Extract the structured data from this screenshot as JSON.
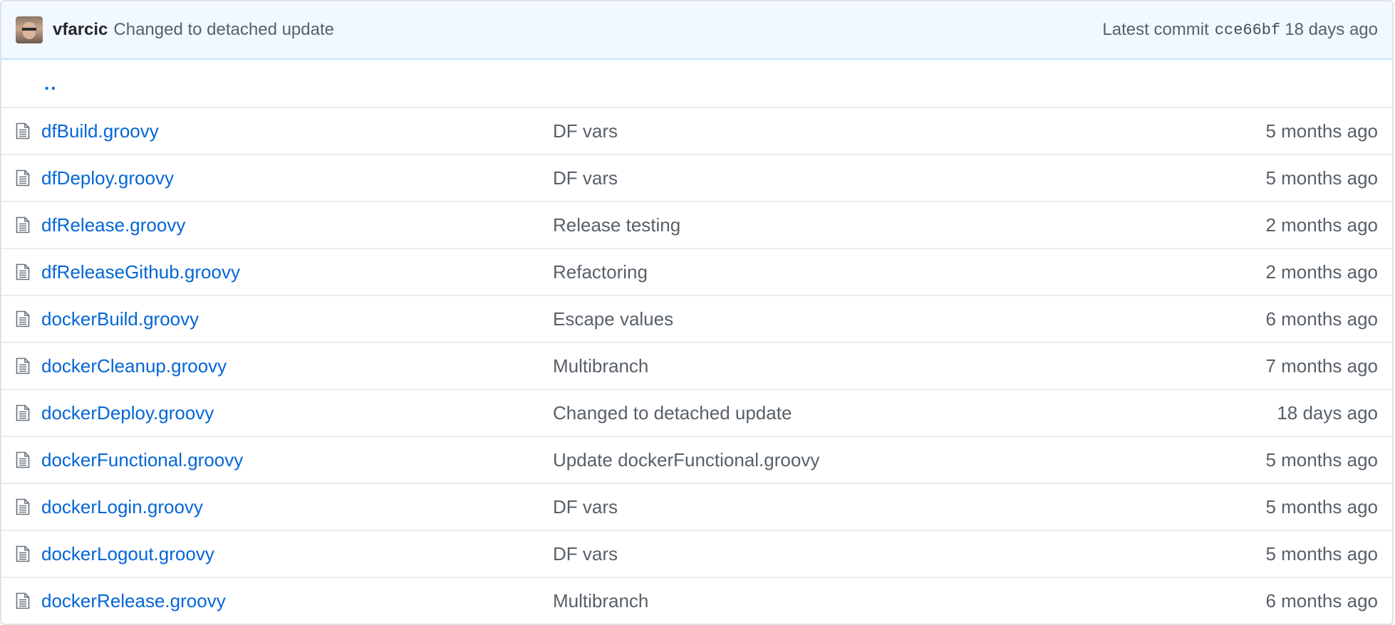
{
  "latest_commit": {
    "author": "vfarcic",
    "message": "Changed to detached update",
    "label": "Latest commit",
    "sha": "cce66bf",
    "age": "18 days ago"
  },
  "parent_link": "..",
  "icons": {
    "avatar": "user-avatar",
    "file": "file-icon"
  },
  "files": [
    {
      "name": "dfBuild.groovy",
      "message": "DF vars",
      "age": "5 months ago"
    },
    {
      "name": "dfDeploy.groovy",
      "message": "DF vars",
      "age": "5 months ago"
    },
    {
      "name": "dfRelease.groovy",
      "message": "Release testing",
      "age": "2 months ago"
    },
    {
      "name": "dfReleaseGithub.groovy",
      "message": "Refactoring",
      "age": "2 months ago"
    },
    {
      "name": "dockerBuild.groovy",
      "message": "Escape values",
      "age": "6 months ago"
    },
    {
      "name": "dockerCleanup.groovy",
      "message": "Multibranch",
      "age": "7 months ago"
    },
    {
      "name": "dockerDeploy.groovy",
      "message": "Changed to detached update",
      "age": "18 days ago"
    },
    {
      "name": "dockerFunctional.groovy",
      "message": "Update dockerFunctional.groovy",
      "age": "5 months ago"
    },
    {
      "name": "dockerLogin.groovy",
      "message": "DF vars",
      "age": "5 months ago"
    },
    {
      "name": "dockerLogout.groovy",
      "message": "DF vars",
      "age": "5 months ago"
    },
    {
      "name": "dockerRelease.groovy",
      "message": "Multibranch",
      "age": "6 months ago"
    }
  ]
}
